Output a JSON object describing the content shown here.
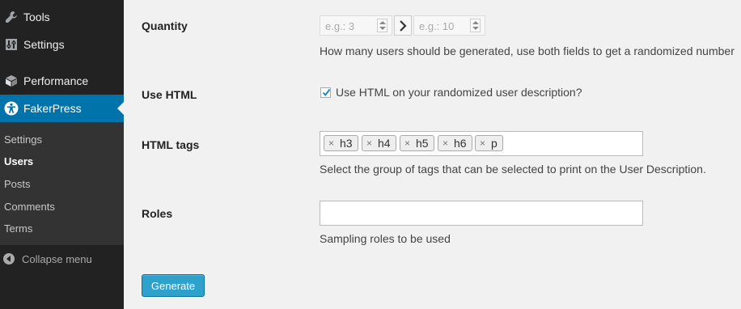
{
  "colors": {
    "sidebar_bg": "#222222",
    "submenu_bg": "#333333",
    "active_bg": "#0073aa",
    "content_bg": "#f1f1f1",
    "button_bg": "#2ea2cc"
  },
  "sidebar": {
    "items": [
      {
        "label": "Tools",
        "icon": "wrench-icon"
      },
      {
        "label": "Settings",
        "icon": "settings-sliders-icon"
      },
      {
        "label": "Performance",
        "icon": "performance-icon"
      },
      {
        "label": "FakerPress",
        "icon": "universal-access-icon",
        "active": true
      }
    ],
    "submenu": [
      {
        "label": "Settings"
      },
      {
        "label": "Users",
        "current": true
      },
      {
        "label": "Posts"
      },
      {
        "label": "Comments"
      },
      {
        "label": "Terms"
      }
    ],
    "collapse_label": "Collapse menu"
  },
  "form": {
    "quantity": {
      "label": "Quantity",
      "min_placeholder": "e.g.: 3",
      "max_placeholder": "e.g.: 10",
      "description": "How many users should be generated, use both fields to get a randomized number"
    },
    "use_html": {
      "label": "Use HTML",
      "checkbox_label": "Use HTML on your randomized user description?",
      "checked": true
    },
    "html_tags": {
      "label": "HTML tags",
      "tags": [
        "h3",
        "h4",
        "h5",
        "h6",
        "p"
      ],
      "remove_symbol": "×",
      "description": "Select the group of tags that can be selected to print on the User Description."
    },
    "roles": {
      "label": "Roles",
      "value": "",
      "description": "Sampling roles to be used"
    },
    "generate_label": "Generate"
  }
}
